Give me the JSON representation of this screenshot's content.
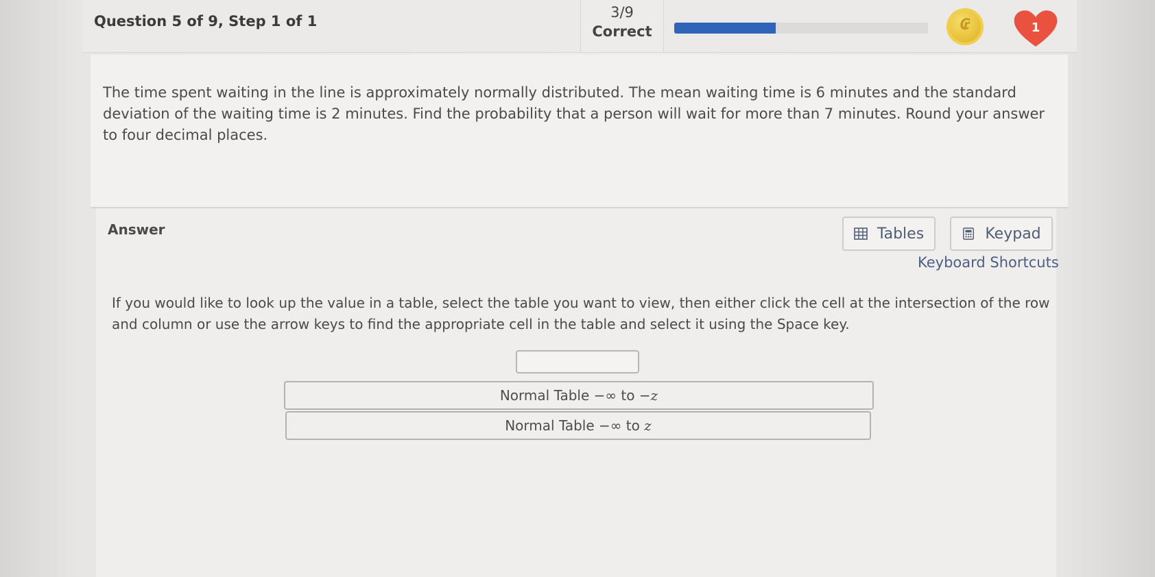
{
  "header": {
    "question_label": "Question 5 of 9, Step 1 of 1",
    "score_fraction": "3/9",
    "score_label": "Correct",
    "progress_fraction": 0.4,
    "hearts_count": "1",
    "coin_icon": "gold-coin-icon",
    "heart_icon": "heart-icon",
    "accent_color": "#2f64b8",
    "heart_color": "#e8523f"
  },
  "question": {
    "text": "The time spent waiting in the line is approximately normally distributed.  The mean waiting time is 6 minutes and the standard deviation of the waiting time is 2 minutes.  Find the probability that a person will wait for more than 7 minutes. Round your answer to four decimal places."
  },
  "answer": {
    "label": "Answer",
    "tables_button": "Tables",
    "keypad_button": "Keypad",
    "keyboard_shortcuts": "Keyboard Shortcuts",
    "instructions": "If you would like to look up the value in a table, select the table you want to view, then either click the cell at the intersection of the row and column or use the arrow keys to find the appropriate cell in the table and select it using the Space key.",
    "input_value": "",
    "table_options": [
      {
        "prefix": "Normal Table −∞ to −",
        "var": "z"
      },
      {
        "prefix": "Normal Table −∞ to ",
        "var": "z"
      }
    ]
  }
}
